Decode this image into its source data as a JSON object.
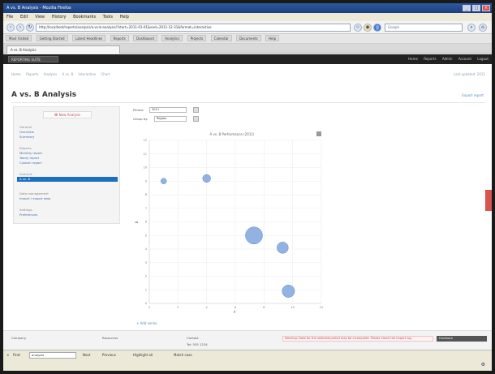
{
  "browser": {
    "title": "A vs. B Analysis - Mozilla Firefox",
    "menu": [
      "File",
      "Edit",
      "View",
      "History",
      "Bookmarks",
      "Tools",
      "Help"
    ],
    "url": "http://localhost/reports/analysis/a-vs-b-analysis/?start=2011-01-01&end=2011-12-31&format=interactive",
    "search_placeholder": "Google",
    "bookmarks": [
      "Most Visited",
      "Getting Started",
      "Latest Headlines",
      "Reports",
      "Dashboard",
      "Analytics",
      "Projects",
      "Calendar",
      "Documents",
      "Help"
    ],
    "tab_title": "A vs. B Analysis",
    "status_find_label": "Find:",
    "status_find_value": "analysis",
    "status_next": "Next",
    "status_prev": "Previous",
    "status_highlight": "Highlight all",
    "status_match_case": "Match case"
  },
  "app": {
    "brand": "REPORTING SUITE",
    "top_links": [
      "Home",
      "Reports",
      "Admin",
      "Account",
      "Logout"
    ],
    "breadcrumbs": [
      "Home",
      "Reports",
      "Analysis",
      "A vs. B",
      "Interactive",
      "Chart"
    ],
    "crumbs_right": "Last updated: 2011",
    "page_title": "A vs. B Analysis",
    "page_link": "Export report",
    "sidebar": {
      "new_button": "New Analysis",
      "sections": [
        {
          "title": "General",
          "items": [
            "Overview",
            "Summary"
          ]
        },
        {
          "title": "Reports",
          "items": [
            "Monthly report",
            "Yearly report",
            "Custom report"
          ]
        },
        {
          "title": "Analysis",
          "items": [
            "A vs. B"
          ],
          "active_index": 0
        },
        {
          "title": "Data management",
          "items": [
            "Import / export data"
          ]
        },
        {
          "title": "Settings",
          "items": [
            "Preferences"
          ]
        }
      ]
    },
    "filters": {
      "label_1": "Period:",
      "value_1": "2011",
      "label_2": "Group by:",
      "value_2": "Region"
    },
    "footer": {
      "col1": "Company",
      "col2": "Resources",
      "col3": "Contact",
      "contact_value": "Tel: 555 1234",
      "warning": "Warning: Data for the selected period may be incomplete. Please check the import log.",
      "dark_label": "Feedback"
    },
    "chart_link": "+ Add series"
  },
  "chart_data": {
    "type": "scatter",
    "title": "A vs. B Performance (2011)",
    "xlabel": "A",
    "ylabel": "B",
    "xlim": [
      0,
      12
    ],
    "ylim": [
      0,
      12
    ],
    "grid": true,
    "series": [
      {
        "color": "#7fa6dd",
        "points": [
          {
            "x": 1,
            "y": 9,
            "size": 1.0
          },
          {
            "x": 4,
            "y": 9.2,
            "size": 1.4
          },
          {
            "x": 7.3,
            "y": 5,
            "size": 3.0
          },
          {
            "x": 9.3,
            "y": 4.1,
            "size": 2.0
          },
          {
            "x": 9.7,
            "y": 0.9,
            "size": 2.2
          }
        ]
      }
    ],
    "x_ticks": [
      0,
      2,
      4,
      6,
      8,
      10,
      12
    ],
    "y_ticks": [
      0,
      1,
      2,
      3,
      4,
      5,
      6,
      7,
      8,
      9,
      10,
      11,
      12
    ]
  }
}
